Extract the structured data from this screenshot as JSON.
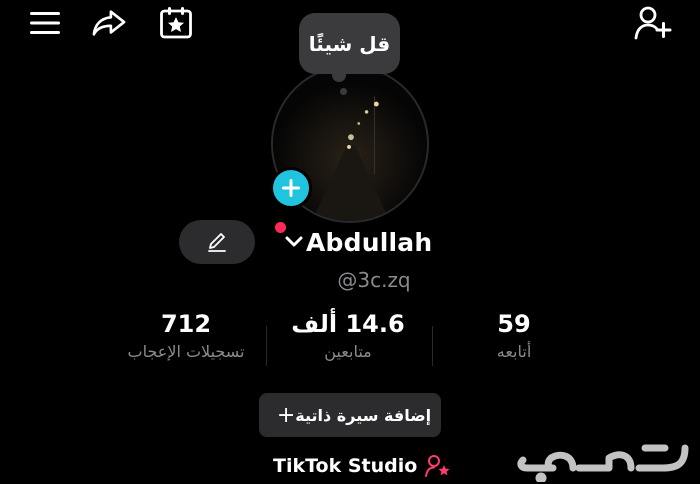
{
  "header": {
    "menu_icon": "hamburger-menu-icon",
    "share_icon": "share-arrow-icon",
    "calendar_icon": "calendar-star-icon",
    "add_friend_icon": "add-user-icon"
  },
  "note": {
    "text": "قل شيئًا"
  },
  "profile": {
    "display_name": "Abdullah",
    "username": "@3c.zq"
  },
  "stats": [
    {
      "value": "712",
      "label": "تسجيلات الإعجاب"
    },
    {
      "value": "14.6 ألف",
      "label": "متابعين"
    },
    {
      "value": "59",
      "label": "أتابعه"
    }
  ],
  "bio_button": {
    "plus": "+",
    "label": "إضافة سيرة ذاتية"
  },
  "studio": {
    "label": "TikTok Studio"
  },
  "watermark": {
    "text": "حراج"
  },
  "colors": {
    "accent_cyan": "#20c4df",
    "live_red": "#ff2a55",
    "studio_pink": "#ff3b6b",
    "muted": "#8a8a8e",
    "button_bg": "#2c2c2e"
  }
}
